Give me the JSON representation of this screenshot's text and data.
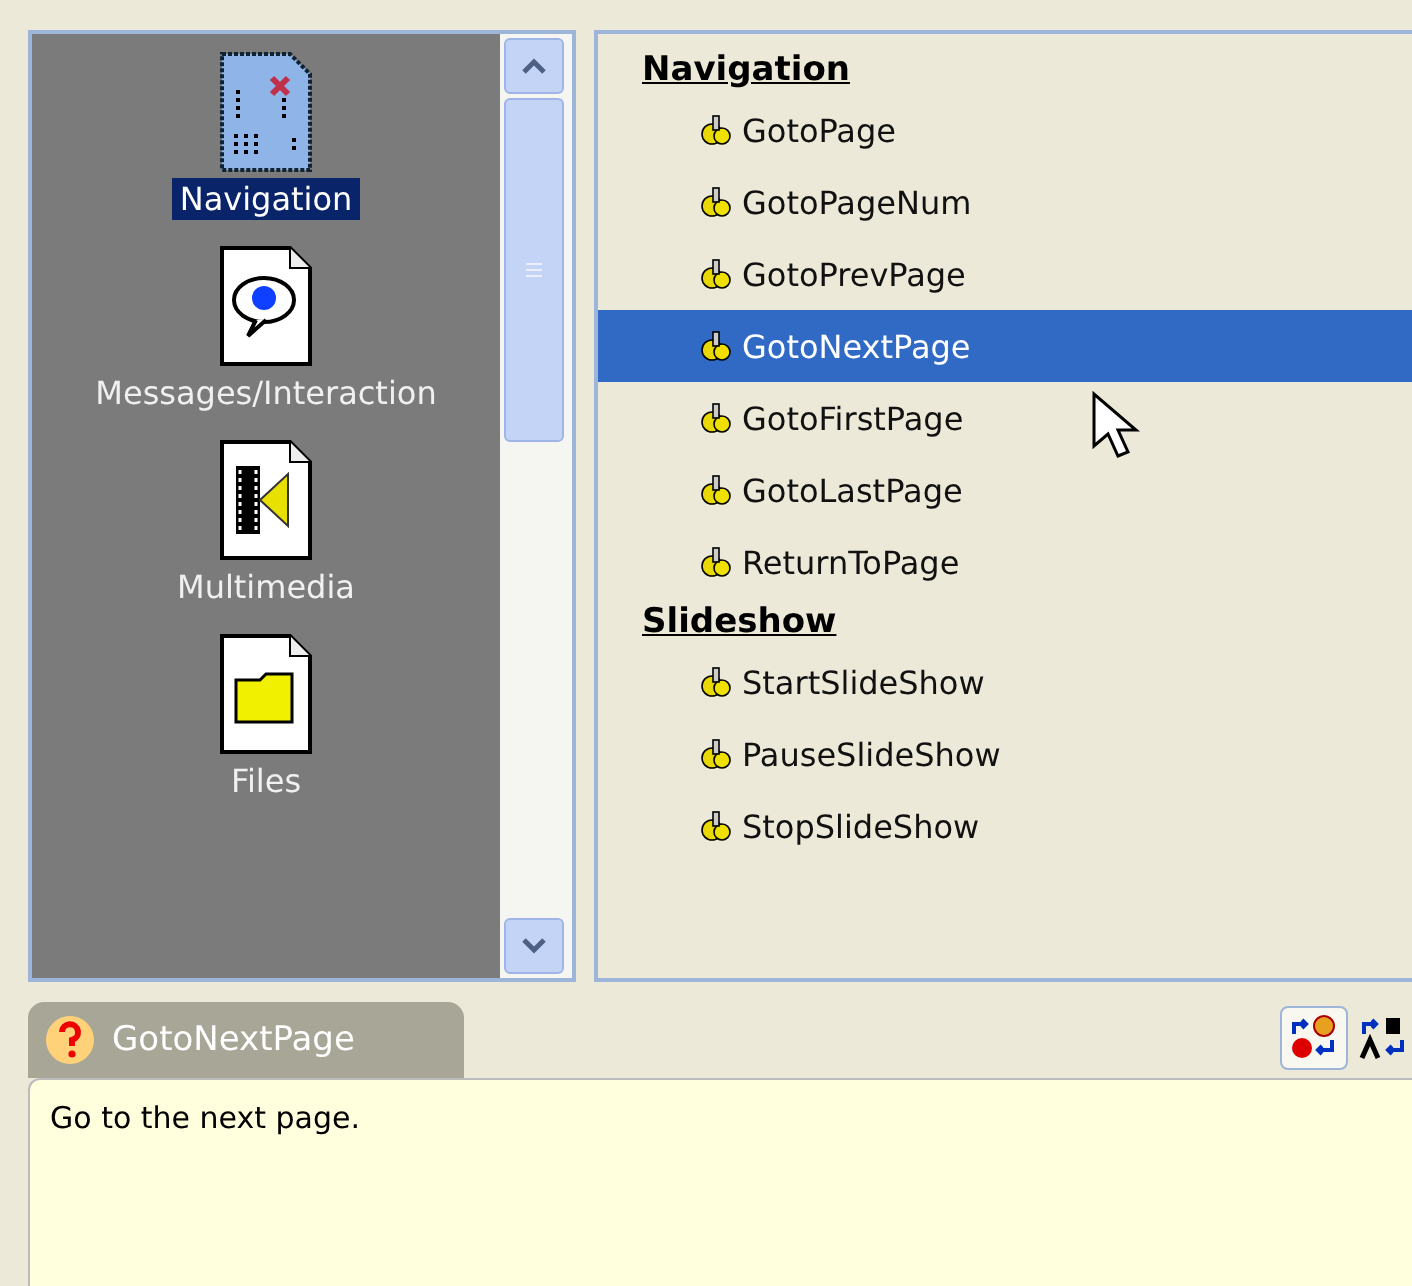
{
  "categories": [
    {
      "label": "Navigation",
      "kind": "navigation",
      "selected": true
    },
    {
      "label": "Messages/Interaction",
      "kind": "message",
      "selected": false
    },
    {
      "label": "Multimedia",
      "kind": "multimedia",
      "selected": false
    },
    {
      "label": "Files",
      "kind": "files",
      "selected": false
    }
  ],
  "actions": [
    {
      "label": "Navigation",
      "children": [
        {
          "label": "GotoPage",
          "selected": false
        },
        {
          "label": "GotoPageNum",
          "selected": false
        },
        {
          "label": "GotoPrevPage",
          "selected": false
        },
        {
          "label": "GotoNextPage",
          "selected": true
        },
        {
          "label": "GotoFirstPage",
          "selected": false
        },
        {
          "label": "GotoLastPage",
          "selected": false
        },
        {
          "label": "ReturnToPage",
          "selected": false
        }
      ]
    },
    {
      "label": "Slideshow",
      "children": [
        {
          "label": "StartSlideShow",
          "selected": false
        },
        {
          "label": "PauseSlideShow",
          "selected": false
        },
        {
          "label": "StopSlideShow",
          "selected": false
        }
      ]
    }
  ],
  "help": {
    "title": "GotoNextPage",
    "text": "Go to the next page."
  }
}
